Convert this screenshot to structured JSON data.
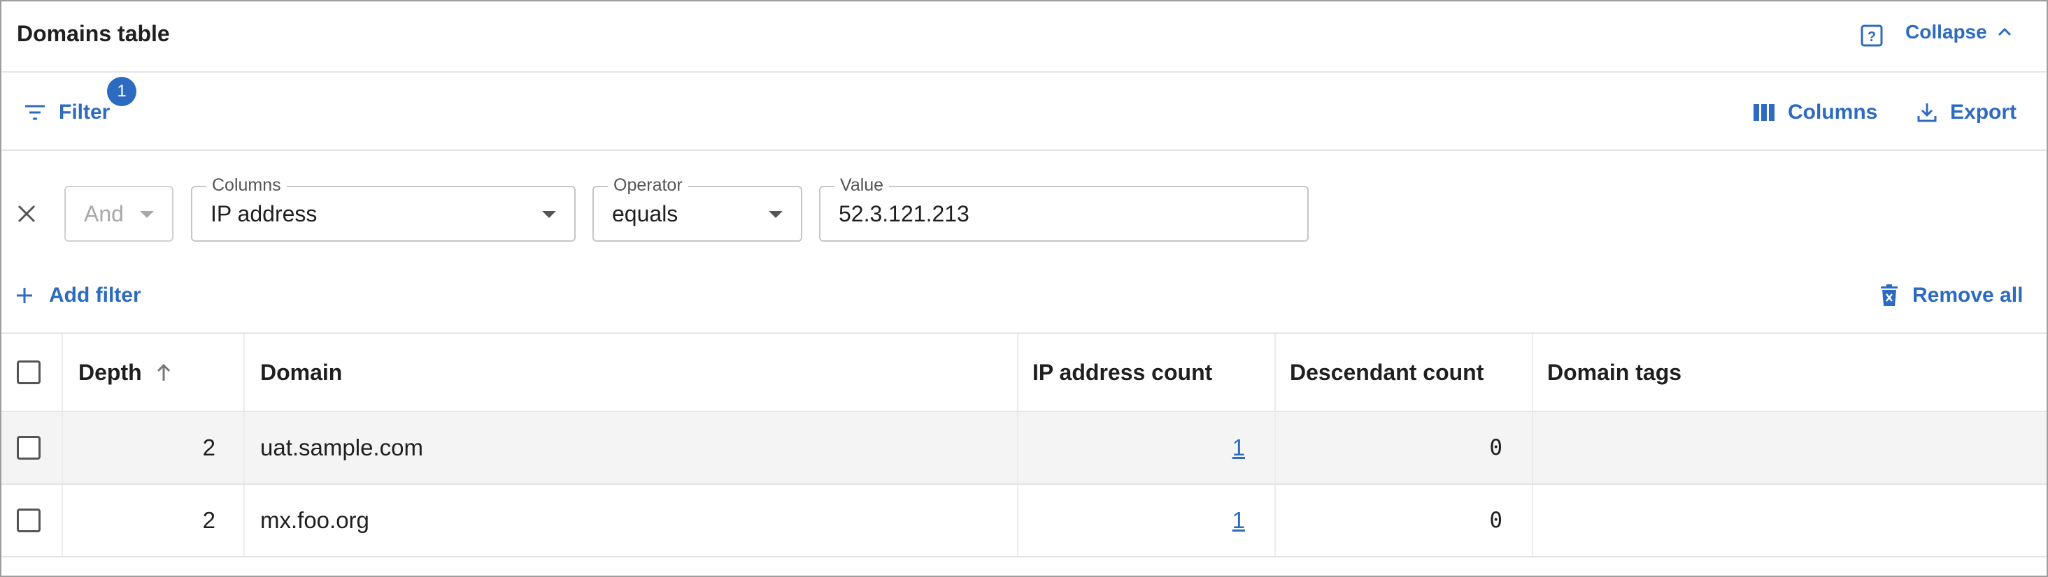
{
  "header": {
    "title": "Domains table",
    "collapse_label": "Collapse"
  },
  "toolbar": {
    "filter_label": "Filter",
    "filter_badge": "1",
    "columns_label": "Columns",
    "export_label": "Export"
  },
  "filter_panel": {
    "logic": {
      "value": "And"
    },
    "column": {
      "legend": "Columns",
      "value": "IP address"
    },
    "operator": {
      "legend": "Operator",
      "value": "equals"
    },
    "value": {
      "legend": "Value",
      "value": "52.3.121.213"
    },
    "add_filter_label": "Add filter",
    "remove_all_label": "Remove all"
  },
  "table": {
    "columns": [
      "Depth",
      "Domain",
      "IP address count",
      "Descendant count",
      "Domain tags"
    ],
    "rows": [
      {
        "depth": "2",
        "domain": "uat.sample.com",
        "ip_count": "1",
        "descendant_count": "0",
        "tags": ""
      },
      {
        "depth": "2",
        "domain": "mx.foo.org",
        "ip_count": "1",
        "descendant_count": "0",
        "tags": ""
      }
    ]
  },
  "colors": {
    "accent": "#2c6bbf",
    "border": "#e4e4e4",
    "row_highlight": "#f4f4f4"
  }
}
